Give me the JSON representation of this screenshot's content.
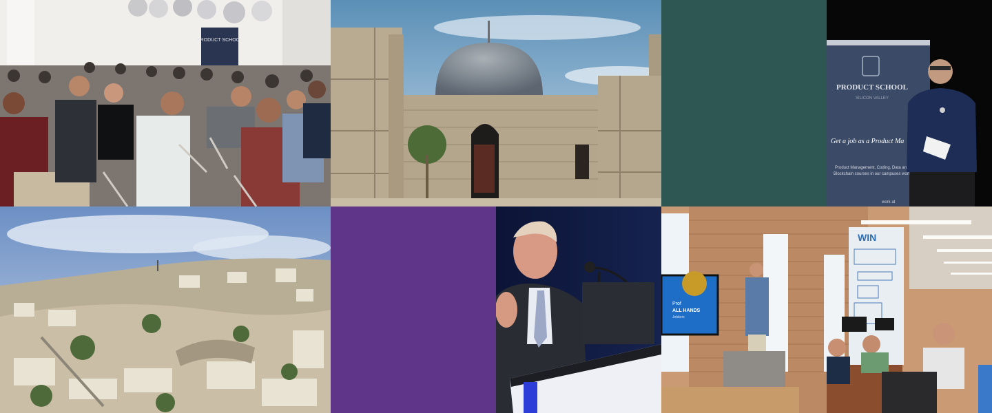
{
  "tiles": [
    {
      "name": "photo-audience-seminar",
      "kind": "photo",
      "banner_text": "PRODUCT SCHOOL"
    },
    {
      "name": "photo-citadel-dome",
      "kind": "photo"
    },
    {
      "name": "color-block-teal",
      "kind": "color",
      "color": "#2e5753"
    },
    {
      "name": "photo-speaker-product-school",
      "kind": "photo",
      "banner": {
        "line1": "PRODUCT SCHOOL",
        "line2": "SILICON VALLEY",
        "line3": "Get a job as a Product Ma",
        "line4": "Product Management, Coding, Data and",
        "line5": "Blockchain courses in our campuses worl",
        "line6": "work at"
      }
    },
    {
      "name": "photo-city-panorama",
      "kind": "photo"
    },
    {
      "name": "color-block-purple",
      "kind": "color",
      "color": "#5e3589"
    },
    {
      "name": "photo-speaker-podium",
      "kind": "photo"
    },
    {
      "name": "photo-office-all-hands",
      "kind": "photo",
      "screen": {
        "line1": "Prof",
        "line2": "ALL HANDS",
        "line3": "Jobbers"
      },
      "wall_text": "WIN"
    }
  ],
  "colors": {
    "teal": "#2e5753",
    "purple": "#5e3589"
  }
}
